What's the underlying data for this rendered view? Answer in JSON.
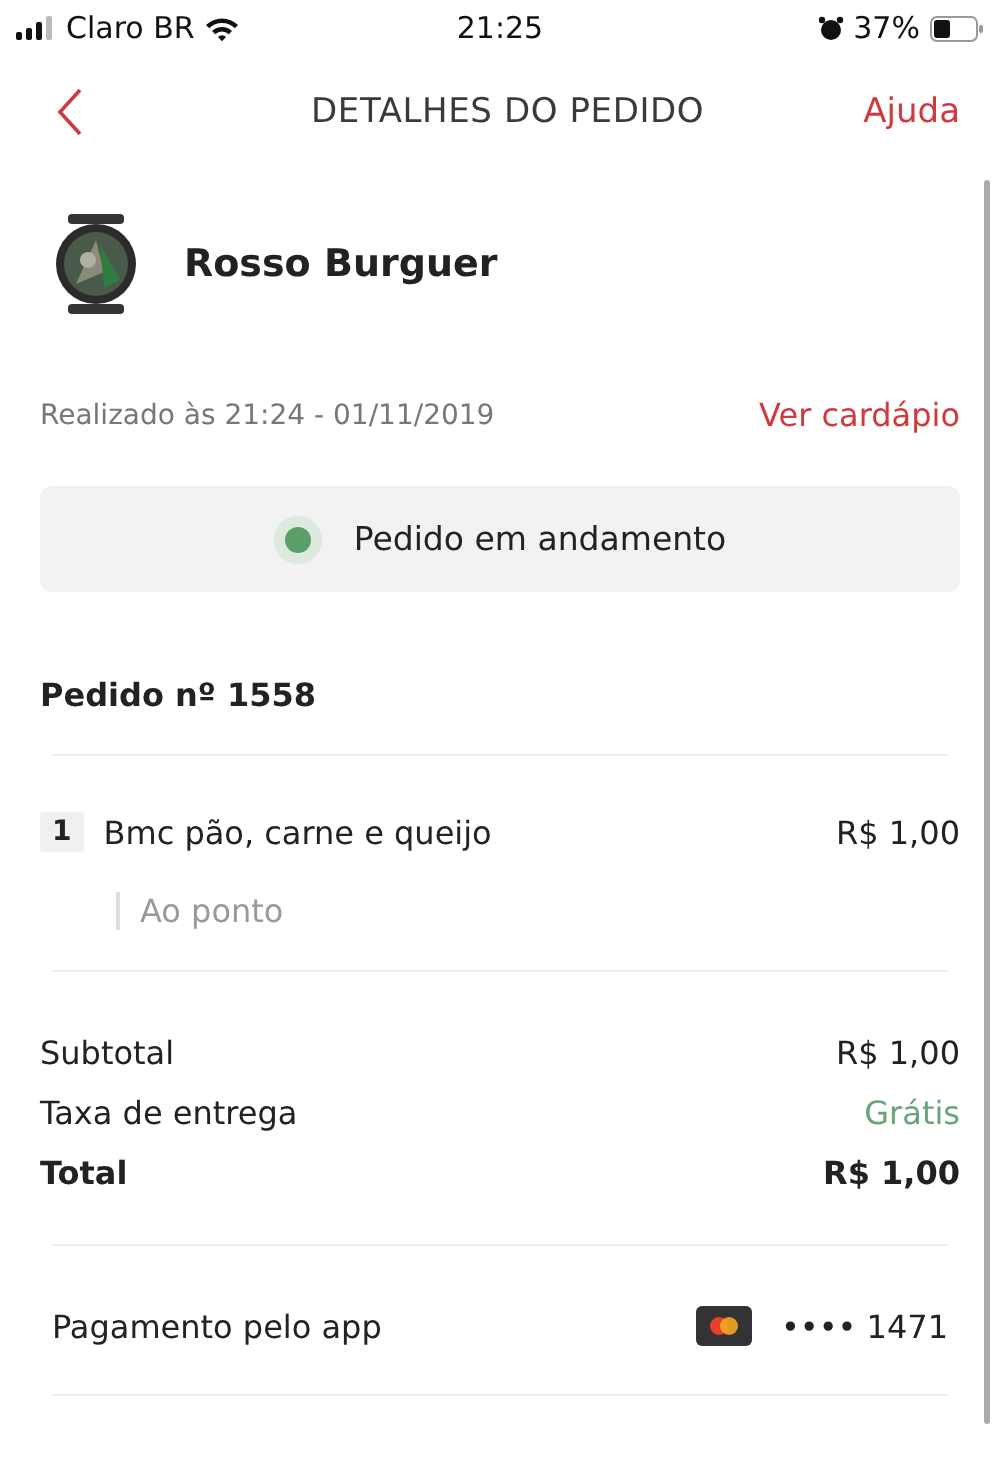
{
  "status_bar": {
    "carrier": "Claro BR",
    "time": "21:25",
    "battery": "37%"
  },
  "header": {
    "title": "DETALHES DO PEDIDO",
    "help": "Ajuda"
  },
  "restaurant": {
    "name": "Rosso Burguer"
  },
  "placed": {
    "text": "Realizado às 21:24 - 01/11/2019",
    "menu_link": "Ver cardápio"
  },
  "order_status": {
    "label": "Pedido em andamento",
    "color": "#5a9e6a"
  },
  "order_number": "Pedido nº 1558",
  "items": [
    {
      "quantity": "1",
      "name": "Bmc pão, carne e queijo",
      "price": "R$ 1,00",
      "notes": [
        "Ao ponto"
      ]
    }
  ],
  "summary": [
    {
      "label": "Subtotal",
      "value": "R$ 1,00",
      "kind": "normal"
    },
    {
      "label": "Taxa de entrega",
      "value": "Grátis",
      "kind": "free"
    },
    {
      "label": "Total",
      "value": "R$ 1,00",
      "kind": "total"
    }
  ],
  "payment": {
    "label": "Pagamento pelo app",
    "card_mask": "•••• 1471"
  }
}
